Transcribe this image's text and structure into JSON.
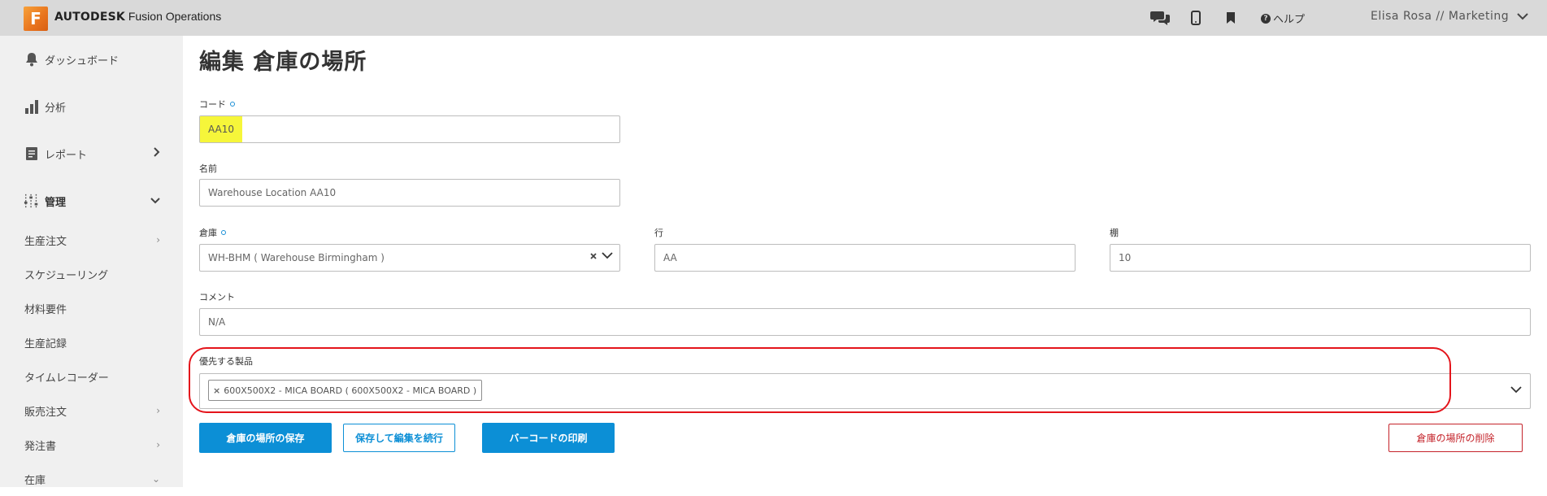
{
  "app": {
    "logo_letter": "F",
    "brand_bold": "AUTODESK",
    "brand_rest": " Fusion Operations",
    "help_label": "ヘルプ",
    "user_label": "Elisa Rosa // Marketing"
  },
  "sidebar": {
    "main_items": [
      {
        "label": "ダッシュボード",
        "icon": "bell-icon"
      },
      {
        "label": "分析",
        "icon": "bar-chart-icon"
      },
      {
        "label": "レポート",
        "icon": "report-icon"
      },
      {
        "label": "管理",
        "icon": "sliders-icon"
      }
    ],
    "sub_items": [
      {
        "label": "生産注文"
      },
      {
        "label": "スケジューリング"
      },
      {
        "label": "材料要件"
      },
      {
        "label": "生産記録"
      },
      {
        "label": "タイムレコーダー"
      },
      {
        "label": "販売注文"
      },
      {
        "label": "発注書"
      },
      {
        "label": "在庫"
      }
    ]
  },
  "page": {
    "title": "編集 倉庫の場所"
  },
  "form": {
    "code": {
      "label": "コード",
      "value": "AA10"
    },
    "name": {
      "label": "名前",
      "value": "Warehouse Location AA10"
    },
    "warehouse": {
      "label": "倉庫",
      "value": "WH-BHM ( Warehouse Birmingham )"
    },
    "row": {
      "label": "行",
      "value": "AA"
    },
    "shelf": {
      "label": "棚",
      "value": "10"
    },
    "comment": {
      "label": "コメント",
      "value": "N/A"
    },
    "preferred_products": {
      "label": "優先する製品",
      "tags": [
        "600X500X2 - MICA BOARD ( 600X500X2 - MICA BOARD )"
      ]
    }
  },
  "buttons": {
    "save": "倉庫の場所の保存",
    "save_continue": "保存して編集を続行",
    "print_barcode": "バーコードの印刷",
    "delete": "倉庫の場所の削除"
  },
  "colors": {
    "accent": "#0c8fd6",
    "danger": "#c4232a",
    "highlight": "#f6f63a",
    "annotation_ring": "#e4141b"
  }
}
